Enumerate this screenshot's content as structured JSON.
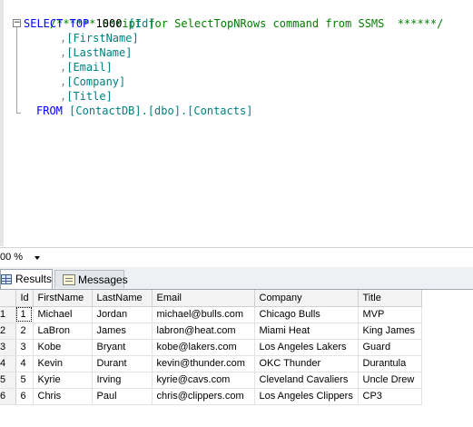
{
  "editor": {
    "comment": "/****** Script for SelectTopNRows command from SSMS  ******/",
    "select_kw": "SELECT",
    "top_kw": "TOP",
    "top_n": "1000",
    "columns": [
      "[Id]",
      "[FirstName]",
      "[LastName]",
      "[Email]",
      "[Company]",
      "[Title]"
    ],
    "comma": ",",
    "from_kw": "FROM",
    "table": "[ContactDB].[dbo].[Contacts]",
    "collapse_glyph": "−"
  },
  "zoom": {
    "value": "00 %"
  },
  "tabs": {
    "results": "Results",
    "messages": "Messages"
  },
  "grid": {
    "headers": [
      "Id",
      "FirstName",
      "LastName",
      "Email",
      "Company",
      "Title"
    ],
    "rows": [
      {
        "n": "1",
        "cells": [
          "1",
          "Michael",
          "Jordan",
          "michael@bulls.com",
          "Chicago Bulls",
          "MVP"
        ]
      },
      {
        "n": "2",
        "cells": [
          "2",
          "LaBron",
          "James",
          "labron@heat.com",
          "Miami Heat",
          "King James"
        ]
      },
      {
        "n": "3",
        "cells": [
          "3",
          "Kobe",
          "Bryant",
          "kobe@lakers.com",
          "Los Angeles Lakers",
          "Guard"
        ]
      },
      {
        "n": "4",
        "cells": [
          "4",
          "Kevin",
          "Durant",
          "kevin@thunder.com",
          "OKC Thunder",
          "Durantula"
        ]
      },
      {
        "n": "5",
        "cells": [
          "5",
          "Kyrie",
          "Irving",
          "kyrie@cavs.com",
          "Cleveland Cavaliers",
          "Uncle Drew"
        ]
      },
      {
        "n": "6",
        "cells": [
          "6",
          "Chris",
          "Paul",
          "chris@clippers.com",
          "Los Angeles Clippers",
          "CP3"
        ]
      }
    ]
  },
  "colors": {
    "keyword": "#0000ff",
    "identifier": "#008080",
    "comment": "#008000",
    "punct": "#808080"
  }
}
